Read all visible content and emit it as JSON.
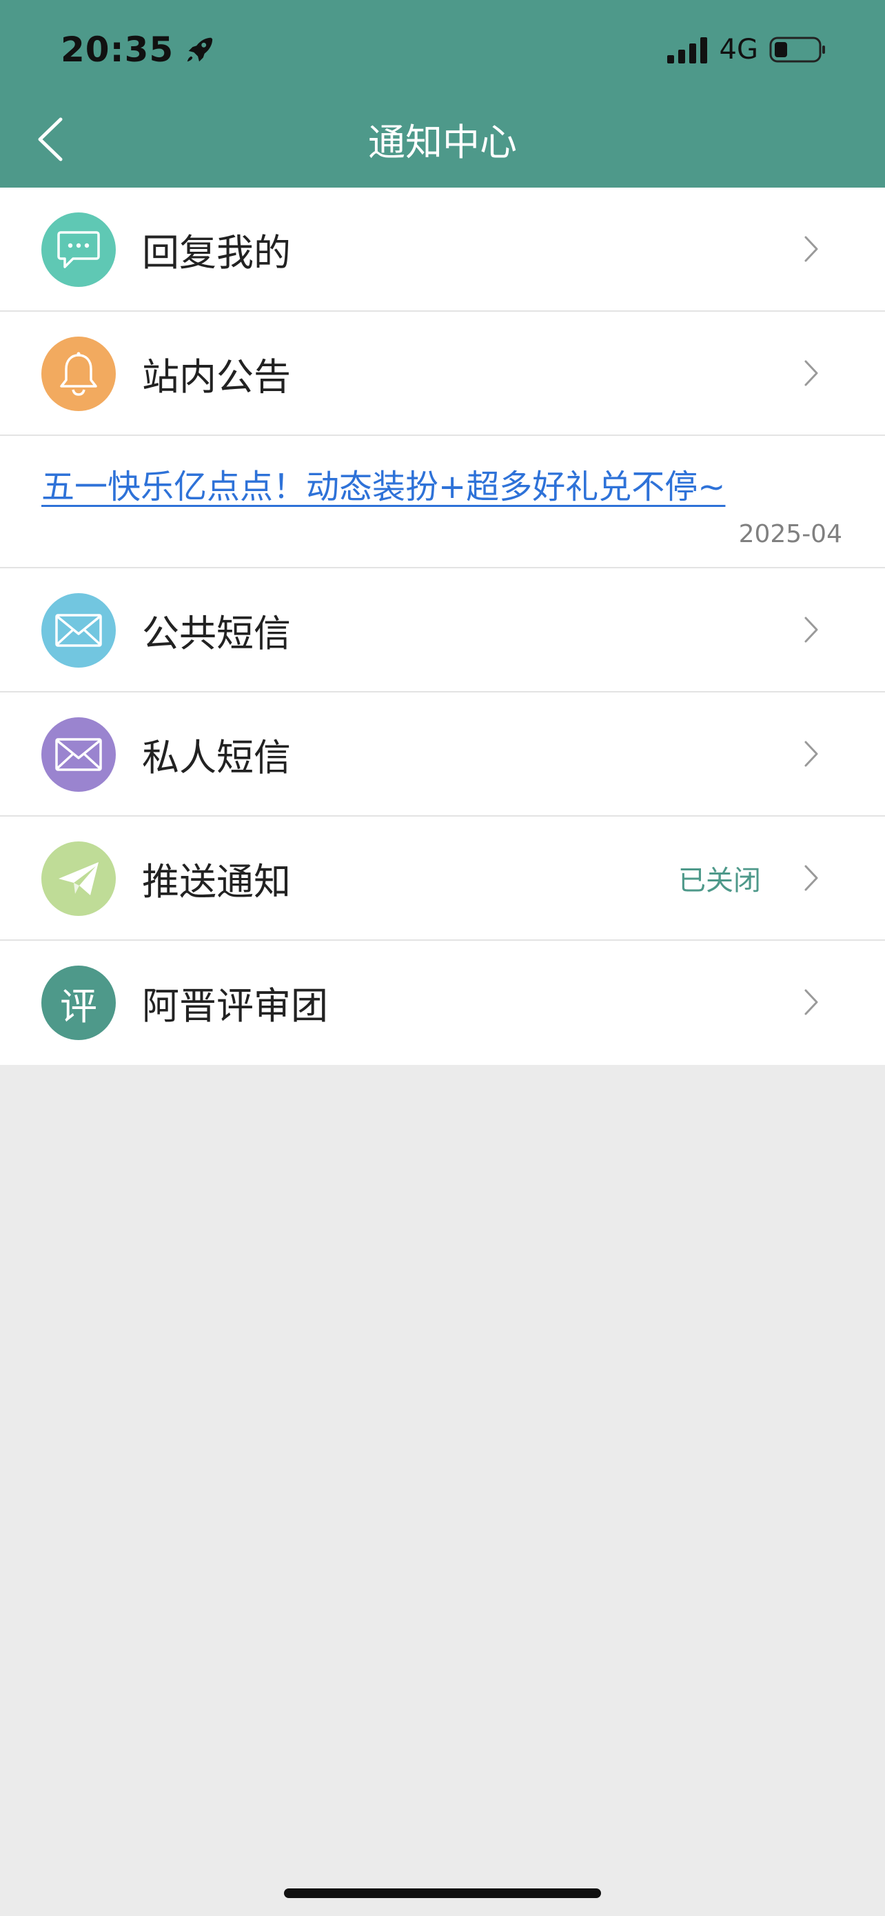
{
  "status_bar": {
    "time": "20:35",
    "network": "4G",
    "icons": [
      "rocket-icon",
      "signal-icon",
      "battery-icon"
    ]
  },
  "header": {
    "title": "通知中心",
    "back_icon": "chevron-left-icon",
    "background_color": "#4e998a"
  },
  "list": {
    "items": [
      {
        "label": "回复我的",
        "icon": "chat-bubble-icon",
        "icon_color": "#5fc8b4"
      },
      {
        "label": "站内公告",
        "icon": "bell-icon",
        "icon_color": "#f2aa5f"
      },
      {
        "label": "公共短信",
        "icon": "envelope-icon",
        "icon_color": "#72c6e0"
      },
      {
        "label": "私人短信",
        "icon": "envelope-icon",
        "icon_color": "#9a84cf"
      },
      {
        "label": "推送通知",
        "icon": "paper-plane-icon",
        "icon_color": "#bfdc97",
        "status": "已关闭"
      },
      {
        "label": "阿晋评审团",
        "icon": "review-badge-icon",
        "icon_color": "#4e998a",
        "icon_text": "评"
      }
    ],
    "announcement": {
      "text": "五一快乐亿点点！动态装扮+超多好礼兑不停~",
      "date": "2025-04"
    }
  },
  "colors": {
    "accent": "#4e998a",
    "link": "#2e72d8",
    "page_background": "#ebebeb"
  }
}
